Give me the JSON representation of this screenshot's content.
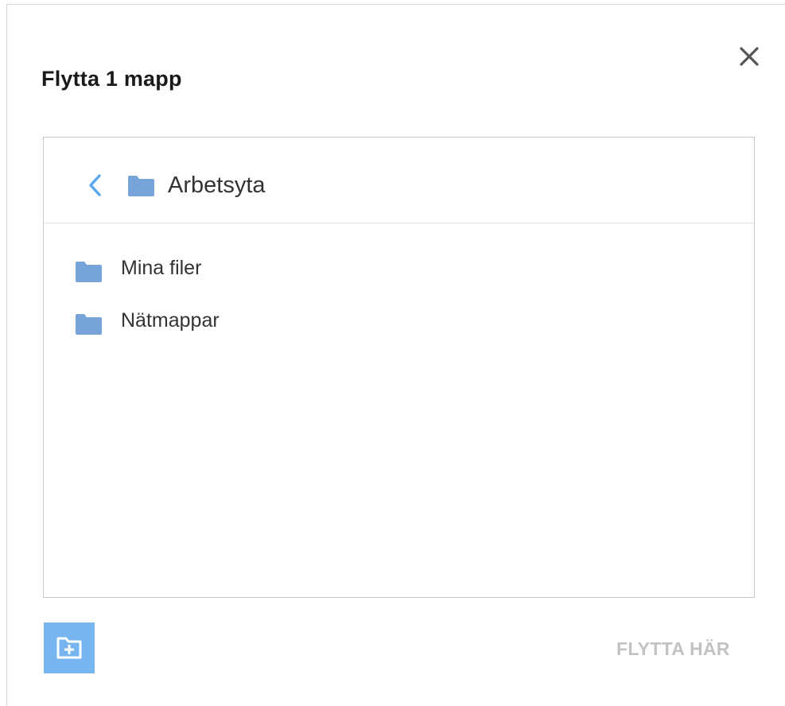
{
  "dialog": {
    "title": "Flytta 1 mapp",
    "close_icon": "close-icon"
  },
  "browser": {
    "current_folder": "Arbetsyta",
    "back_icon": "chevron-left-icon",
    "folders": [
      {
        "label": "Mina filer",
        "icon": "folder-icon"
      },
      {
        "label": "Nätmappar",
        "icon": "folder-icon"
      }
    ]
  },
  "footer": {
    "new_folder_icon": "new-folder-icon",
    "move_here_label": "FLYTTA HÄR"
  },
  "colors": {
    "folder": "#76a3d8",
    "accent": "#76b5f0",
    "back_chevron": "#5aa6ef",
    "disabled_text": "#c2c2c2"
  }
}
